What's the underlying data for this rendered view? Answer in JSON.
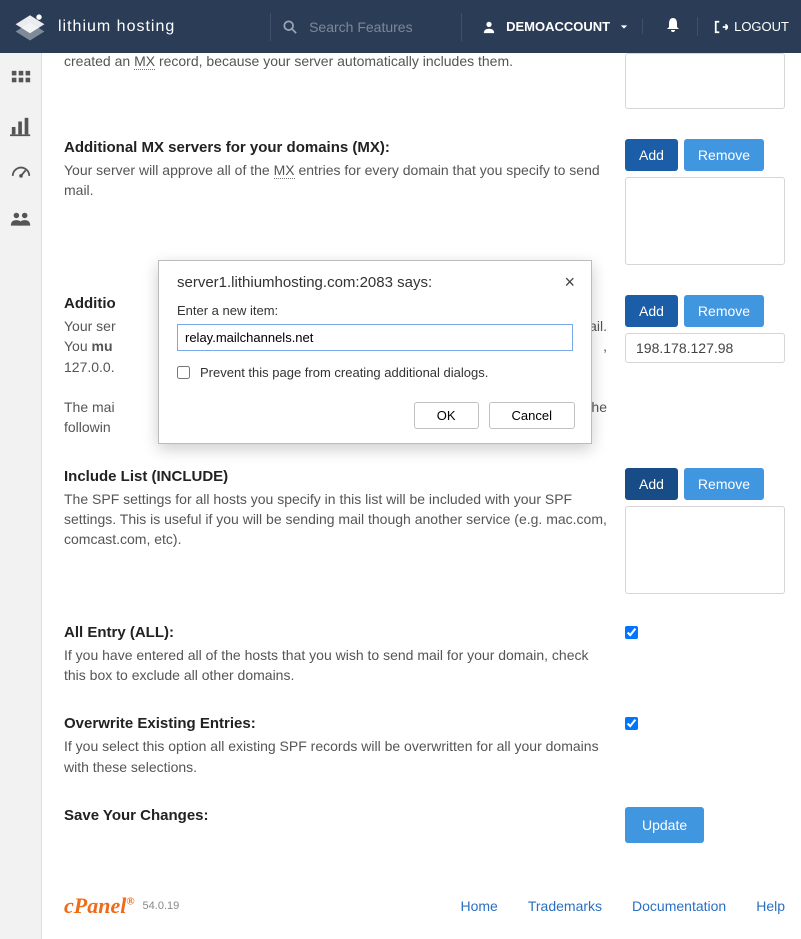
{
  "header": {
    "brand": "lithium hosting",
    "search_placeholder": "Search Features",
    "account_label": "DEMOACCOUNT",
    "logout_label": "LOGOUT"
  },
  "intro_html": "created an MX record, because your server automatically includes them.",
  "intro_prefix": "created an ",
  "intro_mx": "MX",
  "intro_suffix": " record, because your server automatically includes them.",
  "sections": {
    "mx": {
      "title_prefix": "Additional ",
      "title_mx": "MX",
      "title_suffix": " servers for your domains (MX):",
      "desc_prefix": "Your server will approve all of the ",
      "desc_mx": "MX",
      "desc_suffix": " entries for every domain that you specify to send mail."
    },
    "addl": {
      "title": "Additio",
      "desc_l1": "Your ser",
      "desc_l2": "You ",
      "desc_bold": "mu",
      "desc_l3": "127.0.0.",
      "desc_l4": "The mai",
      "desc_l5": "followin",
      "desc_tail_mail": "mail.",
      "desc_tail_comma": ",",
      "desc_tail_the": "The",
      "ip_value": "198.178.127.98"
    },
    "include": {
      "title": "Include List (INCLUDE)",
      "desc": "The SPF settings for all hosts you specify in this list will be included with your SPF settings. This is useful if you will be sending mail though another service (e.g. mac.com, comcast.com, etc)."
    },
    "all": {
      "title": "All Entry (ALL):",
      "desc": "If you have entered all of the hosts that you wish to send mail for your domain, check this box to exclude all other domains."
    },
    "overwrite": {
      "title": "Overwrite Existing Entries:",
      "desc": "If you select this option all existing SPF records will be overwritten for all your domains with these selections."
    },
    "save": {
      "title": "Save Your Changes:"
    }
  },
  "buttons": {
    "add": "Add",
    "remove": "Remove",
    "update": "Update"
  },
  "modal": {
    "title": "server1.lithiumhosting.com:2083 says:",
    "label": "Enter a new item:",
    "value": "relay.mailchannels.net",
    "prevent": "Prevent this page from creating additional dialogs.",
    "ok": "OK",
    "cancel": "Cancel"
  },
  "footer": {
    "cpanel": "cPanel",
    "version": "54.0.19",
    "links": {
      "home": "Home",
      "trademarks": "Trademarks",
      "documentation": "Documentation",
      "help": "Help"
    }
  },
  "colors": {
    "topbar": "#2b3d56",
    "add_btn": "#1b5da6",
    "remove_btn": "#4196e0",
    "link": "#2a70c2",
    "cpanel": "#f06b18"
  }
}
